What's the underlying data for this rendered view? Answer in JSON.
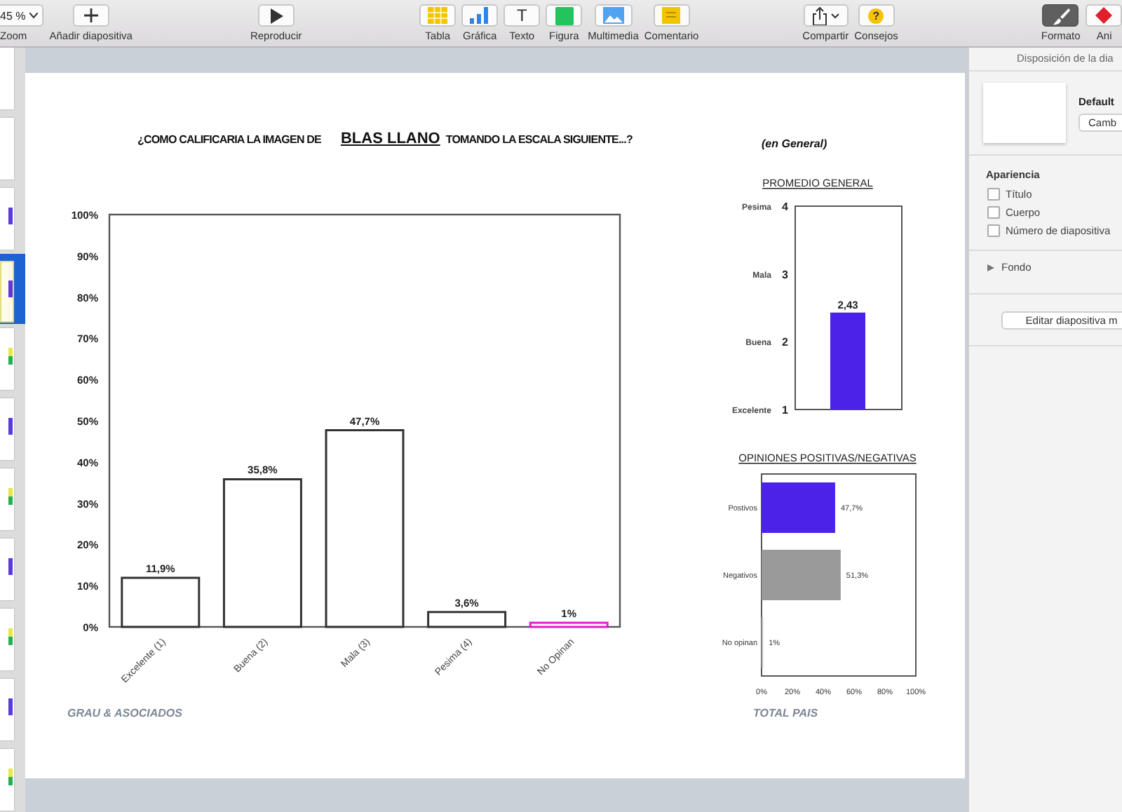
{
  "toolbar": [
    {
      "kind": "zoom",
      "value": "45 %",
      "label": "Zoom",
      "selected": false
    },
    {
      "kind": "add",
      "label": "Añadir diapositiva",
      "selected": false
    },
    {
      "kind": "play",
      "label": "Reproducir",
      "selected": false
    },
    {
      "kind": "table",
      "label": "Tabla",
      "selected": false
    },
    {
      "kind": "chart",
      "label": "Gráfica",
      "selected": false
    },
    {
      "kind": "text",
      "icon_text": "T",
      "label": "Texto",
      "selected": false
    },
    {
      "kind": "shape",
      "label": "Figura",
      "selected": false
    },
    {
      "kind": "media",
      "label": "Multimedia",
      "selected": false
    },
    {
      "kind": "comment",
      "label": "Comentario",
      "selected": false
    },
    {
      "kind": "share",
      "label": "Compartir",
      "selected": false
    },
    {
      "kind": "tips",
      "icon_text": "?",
      "label": "Consejos",
      "selected": false
    },
    {
      "kind": "format",
      "label": "Formato",
      "selected": true
    },
    {
      "kind": "animate",
      "label": "Ani",
      "selected": false
    }
  ],
  "thumbnails": [
    {
      "kind": "blank",
      "selected": false
    },
    {
      "kind": "blank",
      "selected": false
    },
    {
      "kind": "purple",
      "selected": false
    },
    {
      "kind": "purple",
      "selected": true
    },
    {
      "kind": "green",
      "selected": false
    },
    {
      "kind": "purple",
      "selected": false
    },
    {
      "kind": "green",
      "selected": false
    },
    {
      "kind": "purple",
      "selected": false
    },
    {
      "kind": "green",
      "selected": false
    },
    {
      "kind": "purple",
      "selected": false
    },
    {
      "kind": "green",
      "selected": false
    }
  ],
  "slide": {
    "title": {
      "before": "¿COMO CALIFICARIA LA IMAGEN DE",
      "subject": "BLAS LLANO",
      "after": "TOMANDO LA ESCALA SIGUIENTE...?",
      "qualifier": "(en General)"
    },
    "main_chart": {
      "chart_data": {
        "type": "bar",
        "categories": [
          "Excelente (1)",
          "Buena (2)",
          "Mala (3)",
          "Pesima (4)",
          "No Opinan"
        ],
        "values": [
          11.9,
          35.8,
          47.7,
          3.6,
          1
        ],
        "colors": [
          "#333333",
          "#333333",
          "#333333",
          "#333333",
          "#e020d0"
        ],
        "ylim": [
          0,
          100
        ],
        "yticks": [
          {
            "value": 0,
            "label": "0%"
          },
          {
            "value": 10,
            "label": "10%"
          },
          {
            "value": 20,
            "label": "20%"
          },
          {
            "value": 30,
            "label": "30%"
          },
          {
            "value": 40,
            "label": "40%"
          },
          {
            "value": 50,
            "label": "50%"
          },
          {
            "value": 60,
            "label": "60%"
          },
          {
            "value": 70,
            "label": "70%"
          },
          {
            "value": 80,
            "label": "80%"
          },
          {
            "value": 90,
            "label": "90%"
          },
          {
            "value": 100,
            "label": "100%"
          }
        ],
        "value_labels": [
          "11,9%",
          "35,8%",
          "47,7%",
          "3,6%",
          "1%"
        ]
      }
    },
    "average_chart": {
      "chart_data": {
        "type": "bar",
        "title": "PROMEDIO GENERAL",
        "values": [
          2.43
        ],
        "colors": [
          "#4a22e8"
        ],
        "ylim": [
          1,
          4
        ],
        "yticks": [
          {
            "value": 1,
            "label": "1"
          },
          {
            "value": 2,
            "label": "2"
          },
          {
            "value": 3,
            "label": "3"
          },
          {
            "value": 4,
            "label": "4"
          }
        ],
        "annotations": [
          "Excelente",
          "Buena",
          "Mala",
          "Pesima"
        ],
        "value_labels": [
          "2,43"
        ]
      }
    },
    "opinions_chart": {
      "chart_data": {
        "type": "bar",
        "orientation": "horizontal",
        "title": "OPINIONES POSITIVAS/NEGATIVAS",
        "categories": [
          "Postivos",
          "Negativos",
          "No opinan"
        ],
        "values": [
          47.7,
          51.3,
          1
        ],
        "colors": [
          "#4a22e8",
          "#9a9a9a",
          "#bbbbbb"
        ],
        "xlim": [
          0,
          100
        ],
        "xticks": [
          {
            "value": 0,
            "label": "0%"
          },
          {
            "value": 20,
            "label": "20%"
          },
          {
            "value": 40,
            "label": "40%"
          },
          {
            "value": 60,
            "label": "60%"
          },
          {
            "value": 80,
            "label": "80%"
          },
          {
            "value": 100,
            "label": "100%"
          }
        ],
        "value_labels": [
          "47,7%",
          "51,3%",
          "1%"
        ]
      }
    },
    "footer_left": "GRAU & ASOCIADOS",
    "footer_right": "TOTAL PAIS"
  },
  "inspector": {
    "header": "Disposición de la dia",
    "layout_name": "Default",
    "change_button": "Camb",
    "appearance_heading": "Apariencia",
    "options": [
      {
        "label": "Título",
        "checked": false
      },
      {
        "label": "Cuerpo",
        "checked": false
      },
      {
        "label": "Número de diapositiva",
        "checked": false
      }
    ],
    "background_section": {
      "label": "Fondo",
      "expanded": false
    },
    "edit_button": "Editar diapositiva m"
  }
}
